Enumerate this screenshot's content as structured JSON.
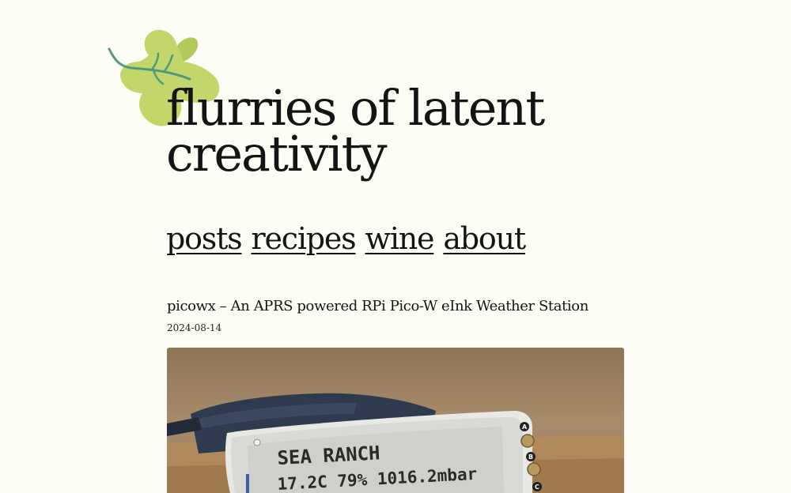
{
  "site": {
    "title_line1": "flurries of latent",
    "title_line2": "creativity"
  },
  "nav": {
    "items": [
      {
        "label": "posts"
      },
      {
        "label": "recipes"
      },
      {
        "label": "wine"
      },
      {
        "label": "about"
      }
    ]
  },
  "post": {
    "title": "picowx – An APRS powered RPi Pico-W eInk Weather Station",
    "date": "2024-08-14",
    "image": {
      "display_line1": "SEA RANCH",
      "display_line2": "17.2C 79% 1016.2mbar",
      "buttons": [
        "A",
        "B",
        "C"
      ]
    }
  },
  "colors": {
    "background": "#fdfdf6",
    "text": "#141414",
    "leaf_light": "#c2d66a",
    "leaf_dark": "#a9c253",
    "leaf_vein": "#4f9a7e"
  },
  "icons": {
    "logo": "leaf-icon"
  }
}
